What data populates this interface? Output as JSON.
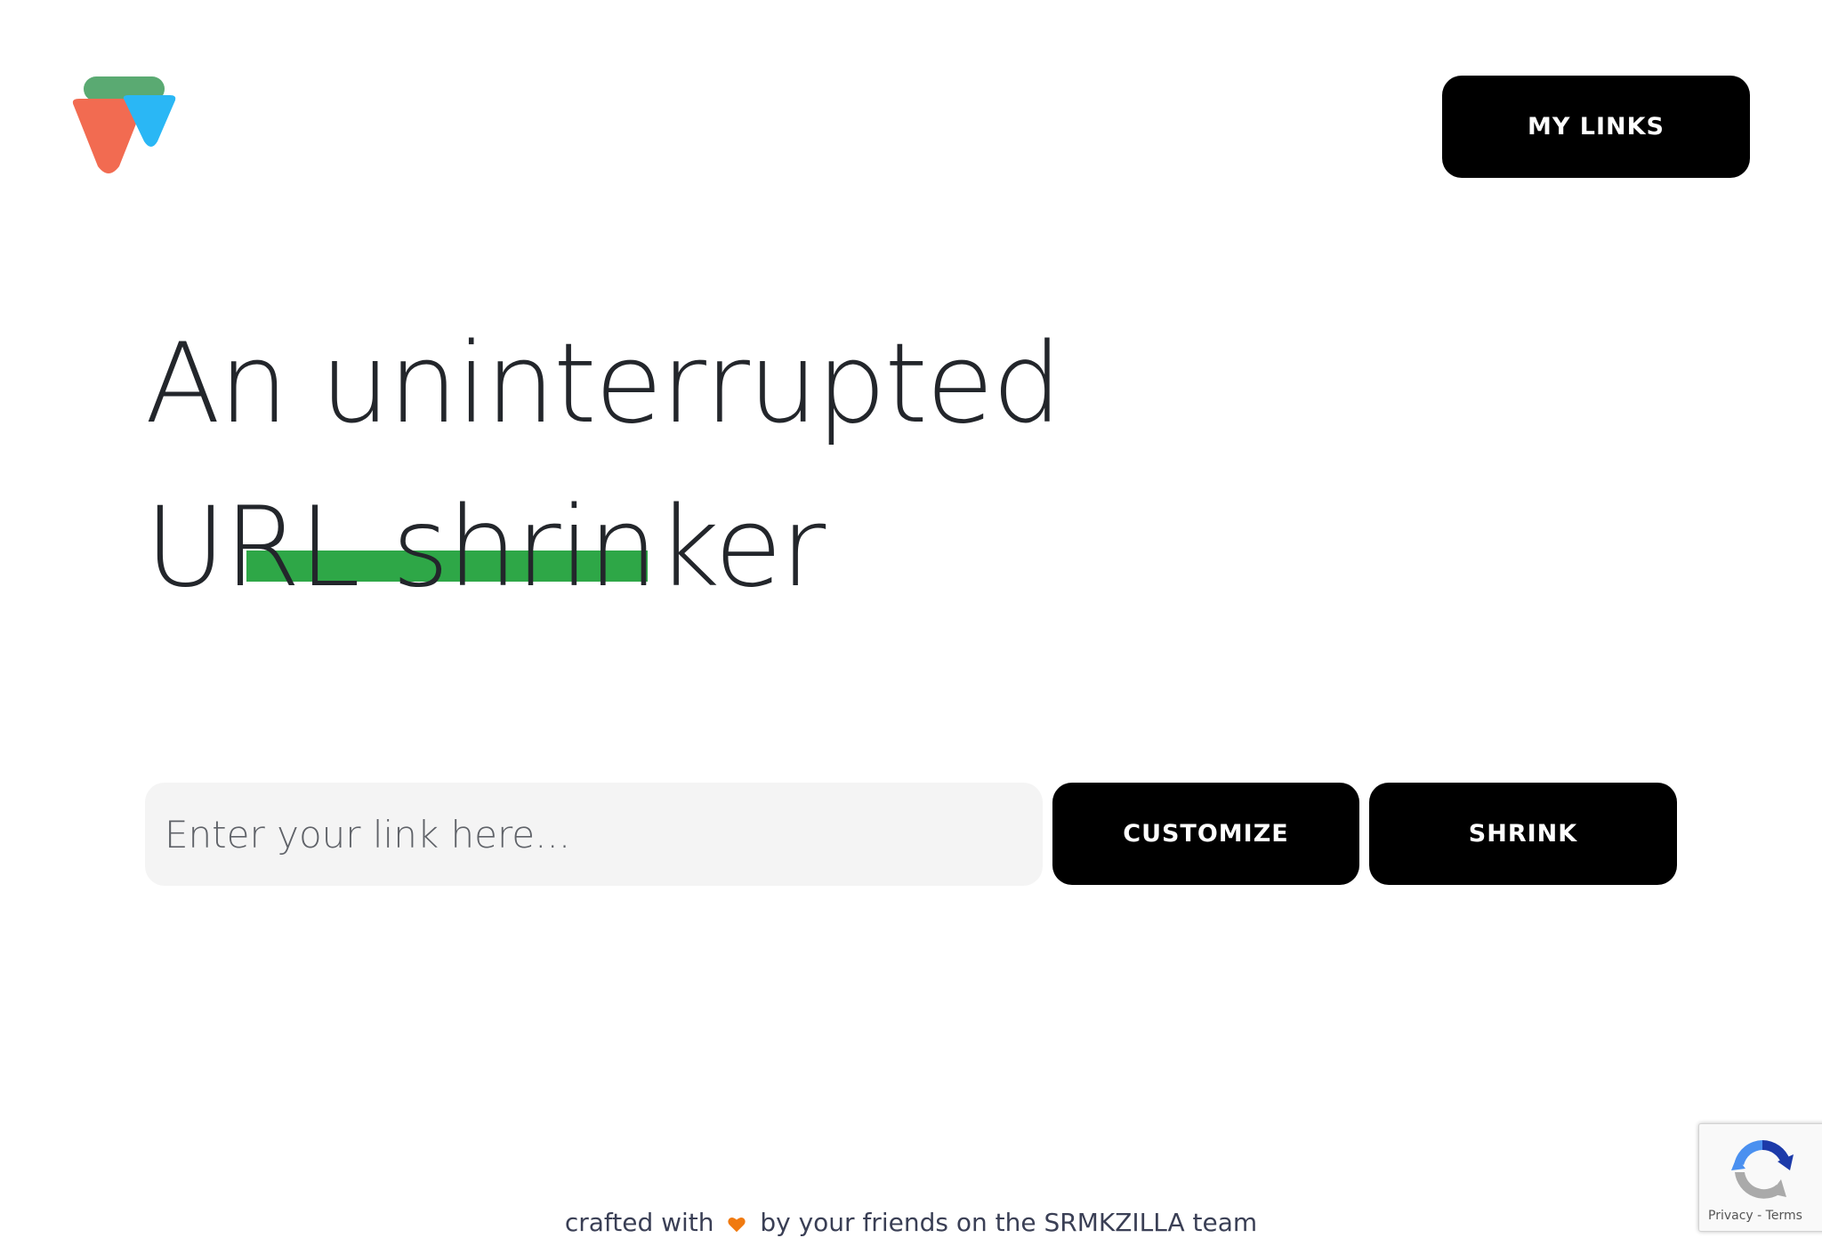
{
  "header": {
    "logo_name": "srmkzilla-logo",
    "my_links_label": "MY LINKS"
  },
  "hero": {
    "line1": "An uninterrupted",
    "line2": "URL shrinker",
    "highlight_color": "#2ea747"
  },
  "shortener": {
    "input_value": "",
    "input_placeholder": "Enter your link here...",
    "customize_label": "CUSTOMIZE",
    "shrink_label": "SHRINK"
  },
  "footer": {
    "prefix": "crafted with",
    "heart_icon": "heart-icon",
    "heart_color": "#f07a10",
    "suffix": "by your friends on the SRMKZILLA team"
  },
  "recaptcha": {
    "icon": "recaptcha-icon",
    "privacy_label": "Privacy",
    "separator": " - ",
    "terms_label": "Terms"
  },
  "colors": {
    "logo_green": "#5aaa72",
    "logo_red": "#f26b51",
    "logo_blue": "#2ab7f5",
    "button_bg": "#000000",
    "input_bg": "#f4f4f4"
  }
}
